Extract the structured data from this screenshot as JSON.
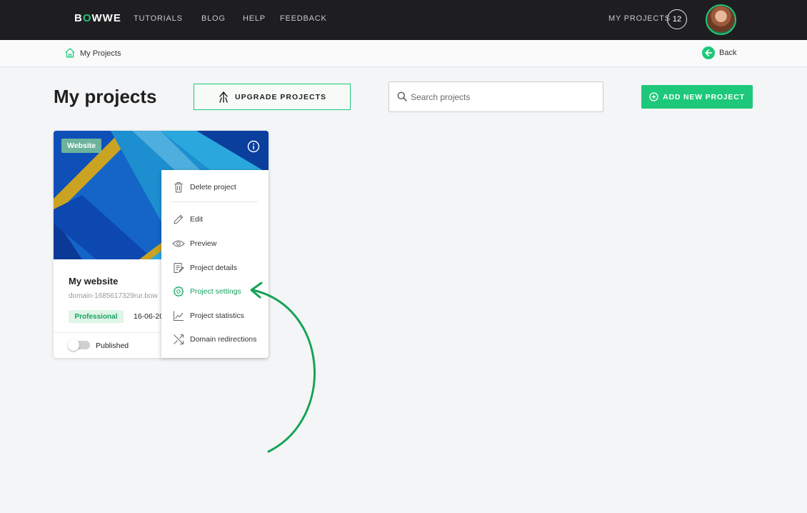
{
  "nav": {
    "logo": "BOWWE",
    "links": [
      "TUTORIALS",
      "BLOG",
      "HELP",
      "FEEDBACK"
    ],
    "my_projects_label": "MY PROJECTS",
    "project_count": "12"
  },
  "breadcrumb": {
    "current": "My Projects",
    "back_label": "Back"
  },
  "header": {
    "title": "My projects",
    "upgrade_label": "UPGRADE PROJECTS",
    "search_placeholder": "Search projects",
    "add_label": "ADD NEW PROJECT"
  },
  "card": {
    "type_badge": "Website",
    "title": "My website",
    "domain": "domain-1685617329rur.bow",
    "plan": "Professional",
    "date": "16-06-20",
    "published_label": "Published",
    "published": false
  },
  "menu": {
    "items": [
      {
        "label": "Delete project",
        "icon": "trash-icon"
      },
      {
        "label": "Edit",
        "icon": "pencil-icon"
      },
      {
        "label": "Preview",
        "icon": "eye-icon"
      },
      {
        "label": "Project details",
        "icon": "document-icon"
      },
      {
        "label": "Project settings",
        "icon": "gear-icon",
        "highlighted": true
      },
      {
        "label": "Project statistics",
        "icon": "chart-icon"
      },
      {
        "label": "Domain redirections",
        "icon": "redirect-icon"
      }
    ]
  },
  "colors": {
    "brand_green": "#1ec87a",
    "nav_bg": "#1e1e21",
    "page_bg": "#f4f5f7"
  }
}
